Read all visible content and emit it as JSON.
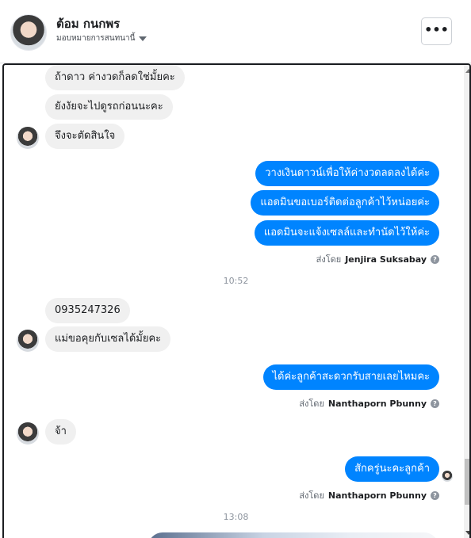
{
  "header": {
    "name": "ต้อม กนกพร",
    "subtitle": "มอบหมายการสนทนานี้",
    "more_label": "•••"
  },
  "messages": {
    "m1": "ถ้าดาว ค่างวดก็ลดใช่มั้ยคะ",
    "m2": "ยังงัยจะไปดูรถก่อนนะคะ",
    "m3": "จึงจะตัดสินใจ",
    "m4": "วางเงินดาวน์เพื่อให้ค่างวดลดลงได้ค่ะ",
    "m5": "แอดมินขอเบอร์ติดต่อลูกค้าไว้หน่อยค่ะ",
    "m6": "แอดมินจะแจ้งเซลล์และทำนัดไว้ให้ค่ะ",
    "m7": "0935247326",
    "m8": "แม่ขอคุยกับเซลได้มั้ยคะ",
    "m9": "ได้ค่ะลูกค้าสะดวกรับสายเลยไหมคะ",
    "m10": "จ้า",
    "m11": "สักครู่นะคะลูกค้า"
  },
  "sent_by": {
    "prefix": "ส่งโดย",
    "s1": "Jenjira Suksabay",
    "s2": "Nanthaporn Pbunny",
    "s3": "Nanthaporn Pbunny",
    "info_icon": "?"
  },
  "times": {
    "t1": "10:52",
    "t2": "13:08"
  },
  "colors": {
    "outgoing": "#0084ff",
    "incoming": "#f0f0f0"
  }
}
